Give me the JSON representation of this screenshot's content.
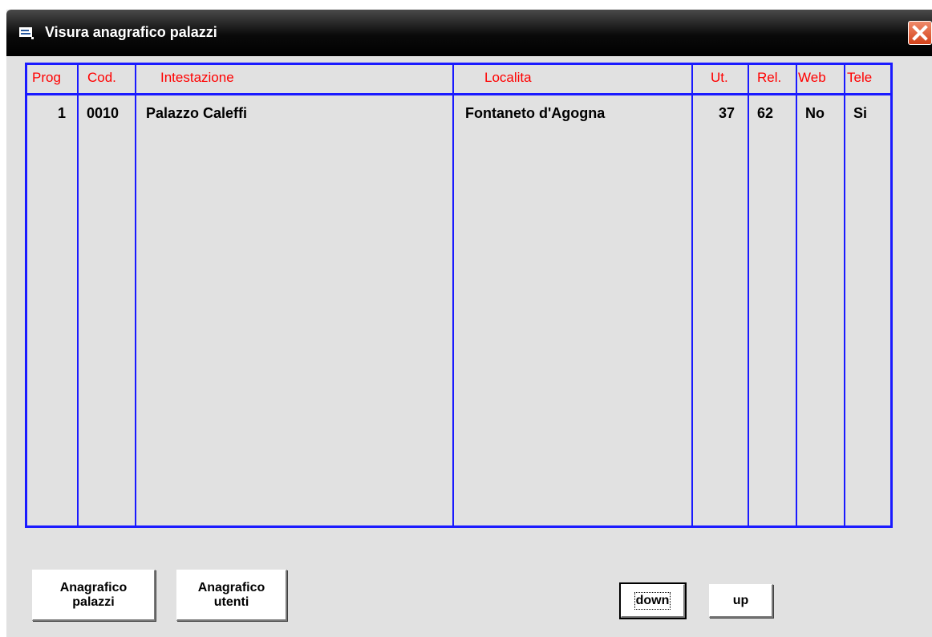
{
  "window": {
    "title": "Visura anagrafico palazzi"
  },
  "table": {
    "headers": {
      "prog": "Prog",
      "cod": "Cod.",
      "intestazione": "Intestazione",
      "localita": "Localita",
      "ut": "Ut.",
      "rel": "Rel.",
      "web": "Web",
      "tele": "Tele"
    },
    "rows": [
      {
        "prog": "1",
        "cod": "0010",
        "intestazione": "Palazzo Caleffi",
        "localita": "Fontaneto d'Agogna",
        "ut": "37",
        "rel": "62",
        "web": "No",
        "tele": "Si"
      }
    ]
  },
  "buttons": {
    "anagrafico_palazzi": {
      "line1": "Anagrafico",
      "line2": "palazzi"
    },
    "anagrafico_utenti": {
      "line1": "Anagrafico",
      "line2": "utenti"
    },
    "down": "down",
    "up": "up"
  },
  "colors": {
    "grid_border": "#1a1aff",
    "header_text": "#ff0000",
    "window_bg": "#e1e1e1"
  }
}
